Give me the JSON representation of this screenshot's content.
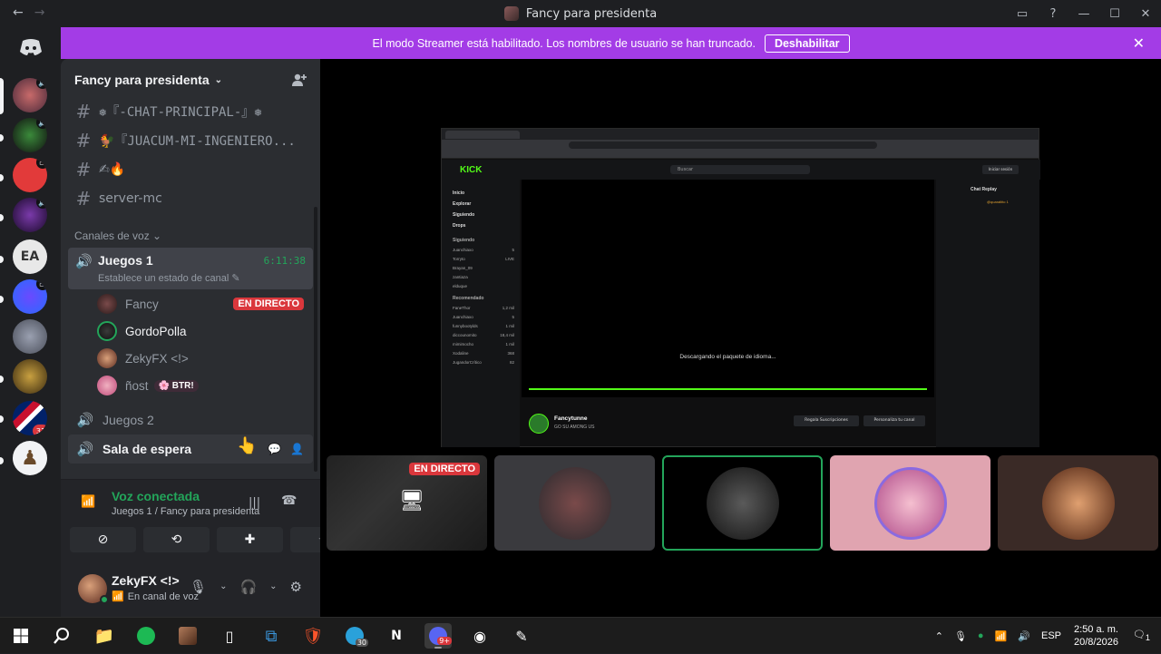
{
  "window": {
    "title": "Fancy para presidenta",
    "back_label": "←",
    "forward_label": "→",
    "controls": {
      "inbox": "▭",
      "help": "?",
      "minimize": "—",
      "maximize": "☐",
      "close": "✕"
    }
  },
  "banner": {
    "message": "El modo Streamer está habilitado. Los nombres de usuario se han truncado.",
    "button": "Deshabilitar",
    "close": "✕"
  },
  "server": {
    "name": "Fancy para presidenta",
    "chevron": "⌄",
    "text_channels": [
      {
        "name": "❅『-CHAT-PRINCIPAL-』❅"
      },
      {
        "name": "🐓『JUACUM-MI-INGENIERO..."
      },
      {
        "name": "✍🔥"
      },
      {
        "name": "server-mc"
      }
    ],
    "voice_category": "Canales de voz ⌄",
    "voice_channels": {
      "juegos1": {
        "name": "Juegos 1",
        "timer": "6:11:38",
        "status": "Establece un estado de canal ✎",
        "users": [
          {
            "name": "Fancy",
            "badge": "EN DIRECTO"
          },
          {
            "name": "GordoPolla"
          },
          {
            "name": "ZekyFX <!>"
          },
          {
            "name": "ñost",
            "tag": "🌸 BTR!"
          }
        ]
      },
      "juegos2": {
        "name": "Juegos 2"
      },
      "espera": {
        "name": "Sala de espera"
      }
    }
  },
  "voice_panel": {
    "title": "Voz conectada",
    "subtitle": "Juegos 1 / Fancy para presidenta",
    "buttons": [
      "camera-off",
      "screen-share",
      "activities",
      "soundboard"
    ]
  },
  "user": {
    "name": "ZekyFX <!>",
    "status": "En canal de voz"
  },
  "stream": {
    "kick": {
      "logo": "KICK",
      "search": "Buscar",
      "login": "Iniciar sesión",
      "nav": [
        "Inicio",
        "Explorar",
        "Siguiendo",
        "Drops"
      ],
      "following_header": "Siguiendo",
      "recommended_header": "Recomendado",
      "following": [
        {
          "name": "Juanchiaxo",
          "meta": "5"
        },
        {
          "name": "Torryto",
          "meta": "LIVE"
        },
        {
          "name": "Brayan_09",
          "meta": ""
        },
        {
          "name": "zantiaza",
          "meta": ""
        },
        {
          "name": "elduque",
          "meta": ""
        }
      ],
      "recommended": [
        {
          "name": "FaneThor",
          "meta": "1,2 mil"
        },
        {
          "name": "Juanchiaxo",
          "meta": "5"
        },
        {
          "name": "funnybootylds",
          "meta": "1 mil"
        },
        {
          "name": "diccounomito",
          "meta": "18,4 mil"
        },
        {
          "name": "mimimocho",
          "meta": "1 mil"
        },
        {
          "name": "Xodaline",
          "meta": "368"
        },
        {
          "name": "JugandorCrítico",
          "meta": "82"
        }
      ],
      "loading_message": "Descargando el paquete de idioma...",
      "streamer": "Fancytunne",
      "stream_title": "GO SU AMONG US",
      "subscribe": "Regala Suscripciones",
      "customize": "Personaliza tu canal",
      "chat_title": "Chat Replay",
      "chat_msg": "@quaraltito 1"
    }
  },
  "thumbnails": [
    {
      "label": "EN DIRECTO",
      "kind": "stream"
    },
    {
      "kind": "avatar"
    },
    {
      "kind": "avatar",
      "selected": true
    },
    {
      "kind": "avatar"
    },
    {
      "kind": "avatar"
    }
  ],
  "taskbar": {
    "language": "ESP",
    "time": "2:50 a. m.",
    "date": "20/8/2026",
    "badges": {
      "telegram": "30",
      "discord": "9+"
    },
    "notification_count": "1"
  },
  "colors": {
    "banner": "#a33ce6",
    "green": "#23a55a",
    "live": "#da373c",
    "kick": "#53fc18"
  }
}
